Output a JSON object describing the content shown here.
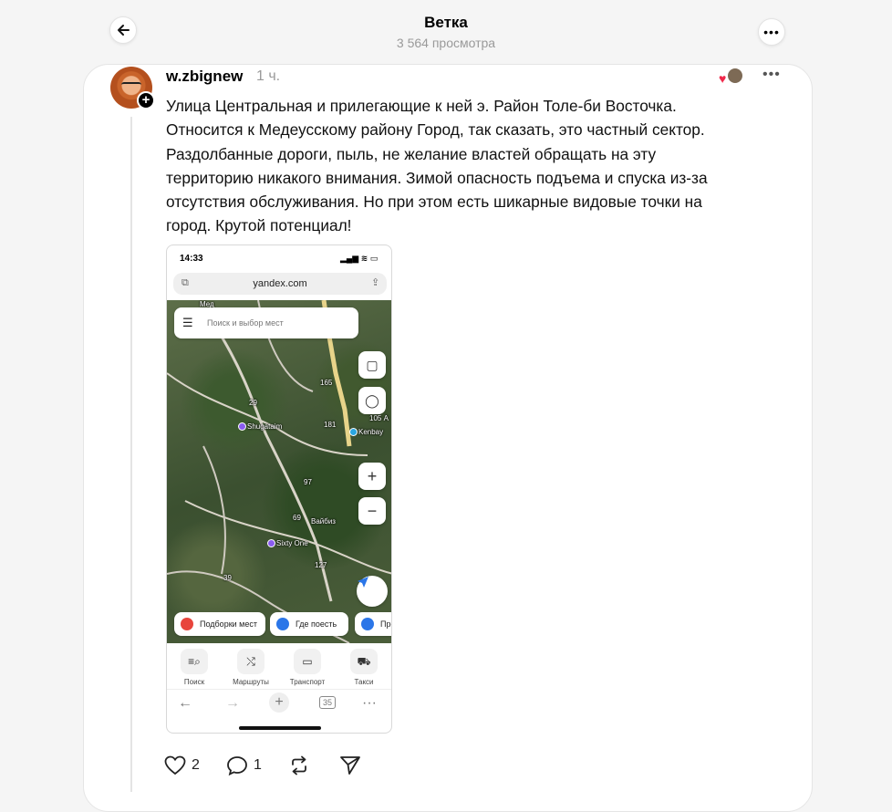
{
  "header": {
    "title": "Ветка",
    "views": "3 564 просмотра"
  },
  "post": {
    "username": "w.zbignew",
    "time": "1 ч.",
    "text": "Улица Центральная и прилегающие к ней э. Район Толе-би Восточка.\nОтносится к Медеусскому району Город, так сказать, это частный сектор.\nРаздолбанные дороги, пыль, не желание властей обращать на эту\nтерриторию никакого внимания. Зимой опасность подъема и спуска из-за\nотсутствия обслуживания. Но при этом есть шикарные видовые точки на\nгород. Крутой потенциал!",
    "likes": "2",
    "comments": "1"
  },
  "screenshot": {
    "clock": "14:33",
    "url": "yandex.com",
    "search_placeholder": "Поиск и выбор мест",
    "map_labels": {
      "shugataim": "Shugataim",
      "kenbay": "Kenbay",
      "vaibiz": "Вайбиз",
      "sixty_one": "Sixty One",
      "n105a": "105 А",
      "n181": "181",
      "n69": "69",
      "n127": "127",
      "n29": "29",
      "n97": "97",
      "n39": "39",
      "n165": "165",
      "top_left": "Мед"
    },
    "chips": [
      "Подборки мест",
      "Где поесть",
      "Прод"
    ],
    "tabs": [
      "Поиск",
      "Маршруты",
      "Транспорт",
      "Такси"
    ],
    "tabs_count": "35"
  },
  "colors": {
    "heart": "#f0284a",
    "chip_red": "#e8453c",
    "chip_blue": "#2b76e8",
    "pin_purple": "#8a5cf0",
    "pin_blue": "#2aa6e0"
  }
}
